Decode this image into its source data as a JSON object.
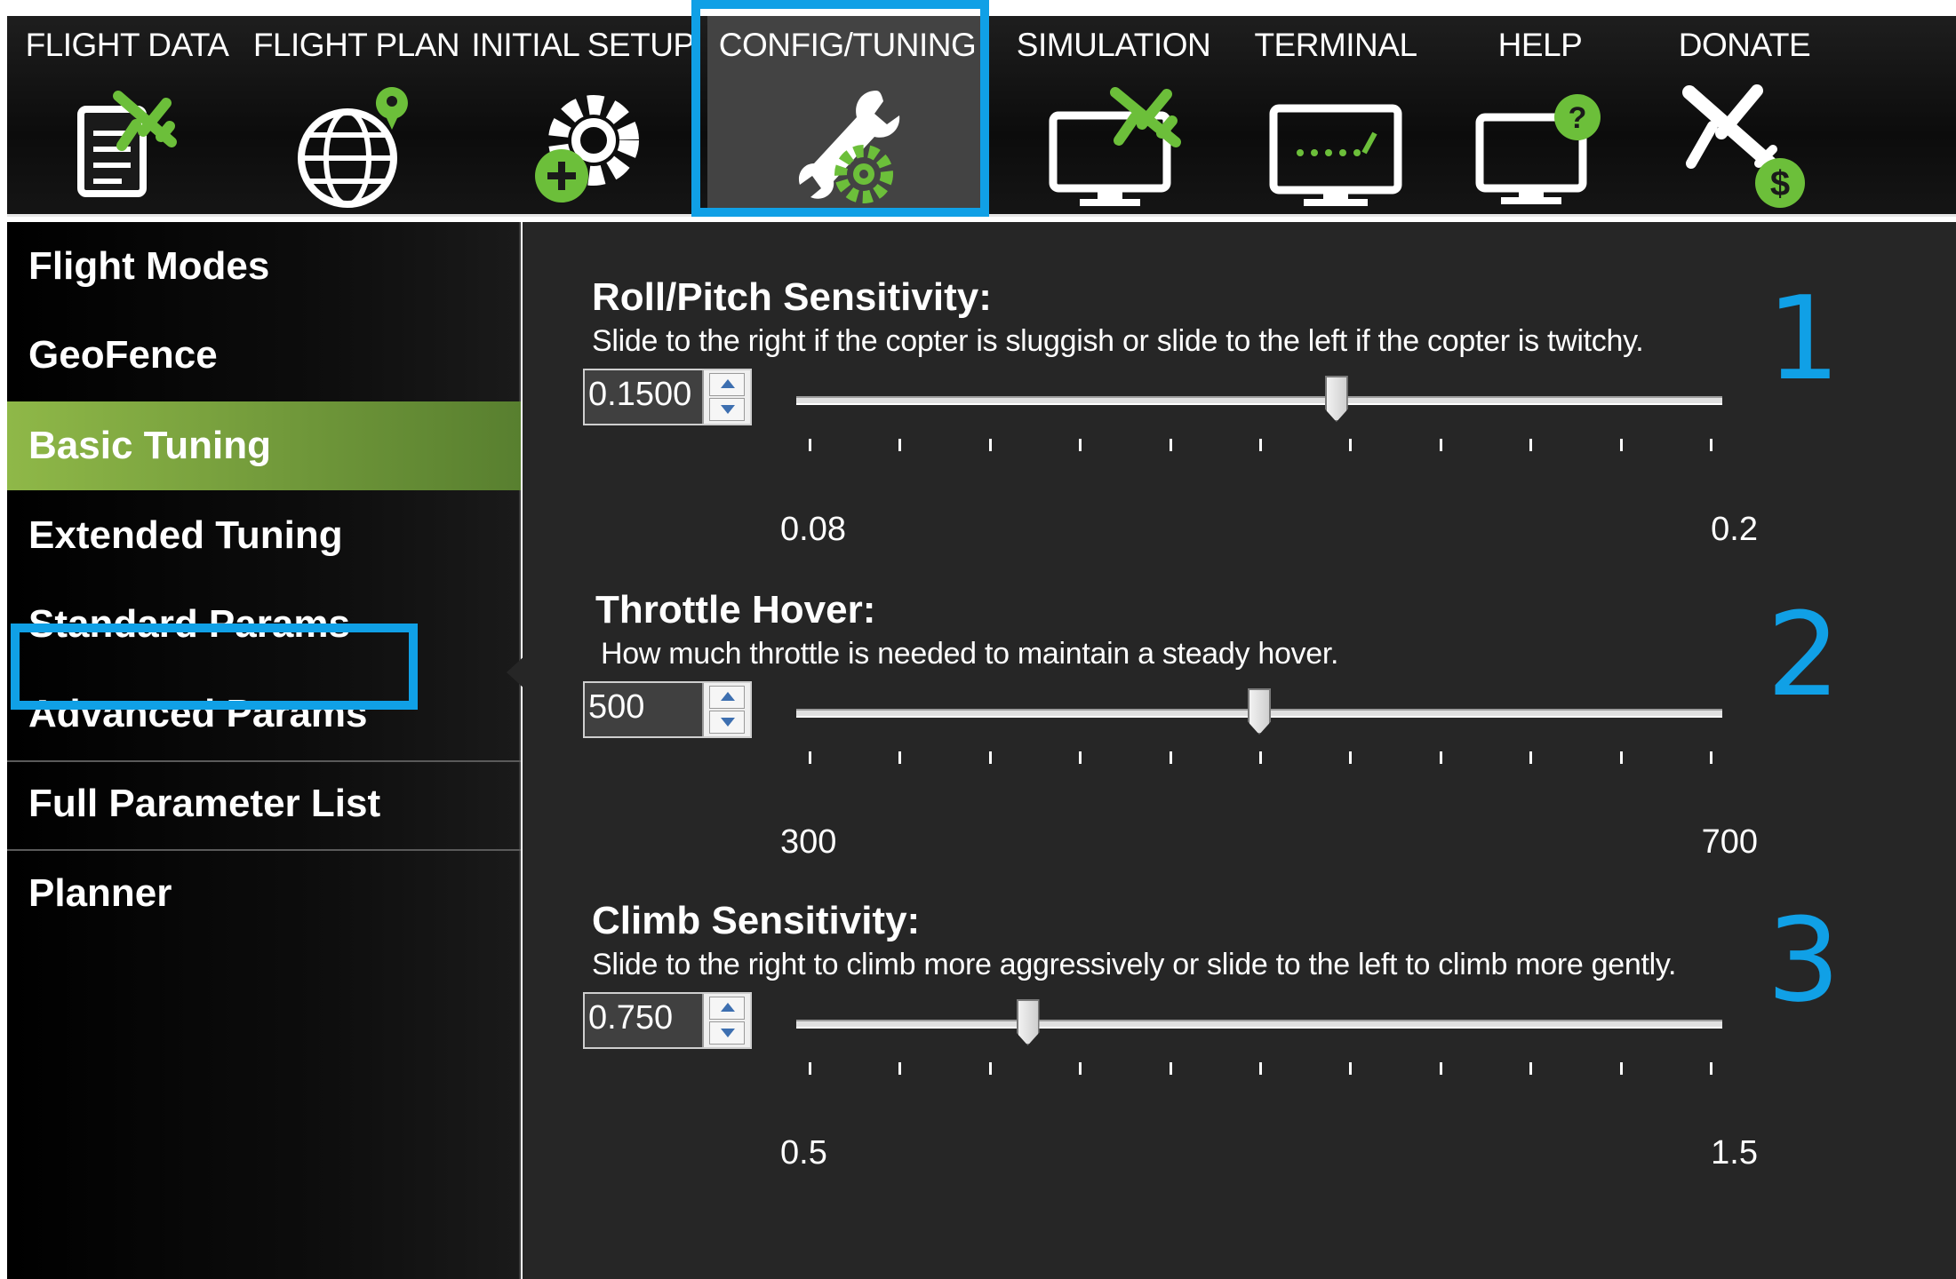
{
  "toolbar": {
    "tabs": [
      {
        "label": "FLIGHT DATA",
        "icon": "flight-data-icon",
        "active": false
      },
      {
        "label": "FLIGHT PLAN",
        "icon": "flight-plan-globe-icon",
        "active": false
      },
      {
        "label": "INITIAL SETUP",
        "icon": "initial-setup-gear-icon",
        "active": false
      },
      {
        "label": "CONFIG/TUNING",
        "icon": "config-tuning-wrench-icon",
        "active": true
      },
      {
        "label": "SIMULATION",
        "icon": "simulation-monitor-icon",
        "active": false
      },
      {
        "label": "TERMINAL",
        "icon": "terminal-monitor-icon",
        "active": false
      },
      {
        "label": "HELP",
        "icon": "help-monitor-icon",
        "active": false
      },
      {
        "label": "DONATE",
        "icon": "donate-plane-icon",
        "active": false
      }
    ]
  },
  "sidebar": {
    "items": [
      {
        "label": "Flight Modes"
      },
      {
        "label": "GeoFence"
      },
      {
        "label": "Basic Tuning",
        "active": true
      },
      {
        "label": "Extended Tuning"
      },
      {
        "label": "Standard Params"
      },
      {
        "label": "Advanced Params"
      },
      {
        "label": "Full Parameter List"
      },
      {
        "label": "Planner"
      }
    ]
  },
  "params": [
    {
      "title": "Roll/Pitch Sensitivity:",
      "description": "Slide to the right if the copter is sluggish or slide to the left if the copter is twitchy.",
      "value": "0.1500",
      "min": "0.08",
      "max": "0.2",
      "min_num": 0.08,
      "max_num": 0.2,
      "value_num": 0.15,
      "callout": "1"
    },
    {
      "title": "Throttle Hover:",
      "description": "How much throttle is needed to maintain a steady hover.",
      "value": "500",
      "min": "300",
      "max": "700",
      "min_num": 300,
      "max_num": 700,
      "value_num": 500,
      "callout": "2"
    },
    {
      "title": "Climb Sensitivity:",
      "description": "Slide to the right to climb more aggressively or slide to the left to climb more gently.",
      "value": "0.750",
      "min": "0.5",
      "max": "1.5",
      "min_num": 0.5,
      "max_num": 1.5,
      "value_num": 0.75,
      "callout": "3"
    }
  ],
  "colors": {
    "highlight": "#10a0e6",
    "active_sidebar": "#6f9a3a",
    "panel_bg": "#262626",
    "icon_green": "#6cbf3a"
  }
}
